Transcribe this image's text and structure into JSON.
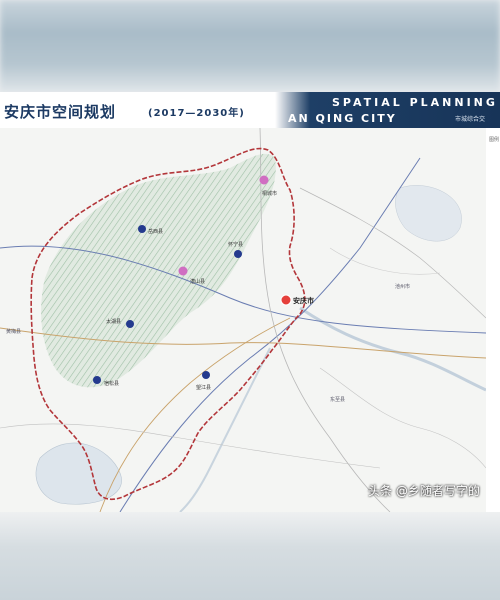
{
  "title": {
    "cn": "安庆市空间规划",
    "years": "(2017—2030年)",
    "en_line1": "SPATIAL  PLANNING",
    "en_line2": "AN QING CITY",
    "subtitle": "市城综合交"
  },
  "legend": {
    "label": "图例"
  },
  "map": {
    "places": [
      {
        "id": "anqing",
        "name": "安庆市",
        "type": "city"
      },
      {
        "id": "taihu",
        "name": "太湖县",
        "type": "county"
      },
      {
        "id": "susong",
        "name": "宿松县",
        "type": "county"
      },
      {
        "id": "wangjiang",
        "name": "望江县",
        "type": "county"
      },
      {
        "id": "qianshan",
        "name": "潜山县",
        "type": "county-secondary"
      },
      {
        "id": "tongcheng",
        "name": "桐城市",
        "type": "county-secondary"
      },
      {
        "id": "yuexi",
        "name": "岳西县",
        "type": "county"
      },
      {
        "id": "huaining",
        "name": "怀宁县",
        "type": "county"
      },
      {
        "id": "dongzhi",
        "name": "东至县",
        "type": "outside"
      },
      {
        "id": "chizhou",
        "name": "池州市",
        "type": "outside"
      },
      {
        "id": "huangmei",
        "name": "黄梅县",
        "type": "outside"
      }
    ],
    "colors": {
      "boundary": "#b3363a",
      "mountains": "#8fb89a",
      "rail": "#5a6ea8",
      "road": "#c9a36b",
      "city_marker": "#e5403b",
      "county_marker": "#243a8e",
      "secondary_marker": "#d06ec2",
      "water": "#d9e2ea"
    }
  },
  "watermark": {
    "text": "头条 @乡随者写字的"
  }
}
